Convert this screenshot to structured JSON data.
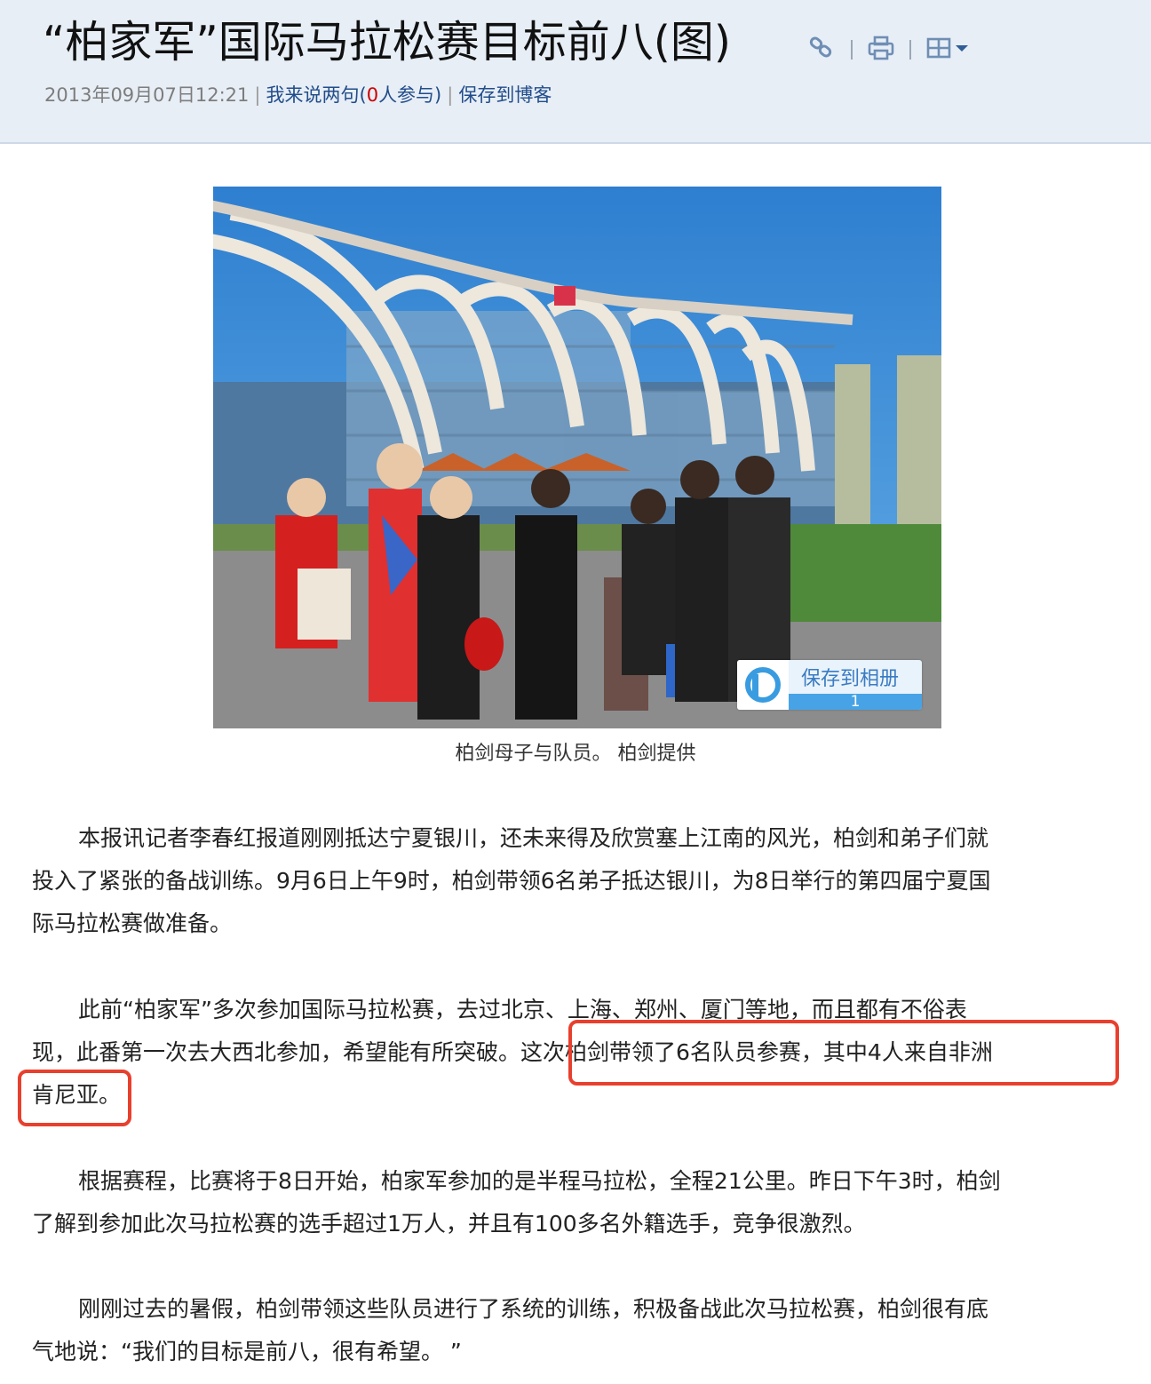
{
  "article": {
    "title": "“柏家军”国际马拉松赛目标前八(图)",
    "date": "2013年09月07日12:21",
    "comment_pre": "我来说两句(",
    "comment_count": "0",
    "comment_post": "人参与)",
    "save_blog": "保存到博客"
  },
  "toolbar": {
    "icons": [
      "link-icon",
      "print-icon",
      "font-size-icon"
    ]
  },
  "photo": {
    "save_album_label": "保存到相册",
    "save_album_count": "1",
    "caption": "柏剑母子与队员。 柏剑提供"
  },
  "paragraphs": [
    [
      "本报讯记者李春红报道刚刚抵达宁夏银川，还未来得及欣赏塞上江南的风光，柏剑和弟子们就",
      "投入了紧张的备战训练。9月6日上午9时，柏剑带领6名弟子抵达银川，为8日举行的第四届宁夏国",
      "际马拉松赛做准备。"
    ],
    [
      "此前“柏家军”多次参加国际马拉松赛，去过北京、上海、郑州、厦门等地，而且都有不俗表",
      "现，此番第一次去大西北参加，希望能有所突破。这次柏剑带领了6名队员参赛，其中4人来自非洲",
      "肯尼亚。"
    ],
    [
      "根据赛程，比赛将于8日开始，柏家军参加的是半程马拉松，全程21公里。昨日下午3时，柏剑",
      "了解到参加此次马拉松赛的选手超过1万人，并且有100多名外籍选手，竞争很激烈。"
    ],
    [
      "刚刚过去的暑假，柏剑带领这些队员进行了系统的训练，积极备战此次马拉松赛，柏剑很有底",
      "气地说：“我们的目标是前八，很有希望。 ”"
    ]
  ],
  "colors": {
    "header_bg": "#e7eef6",
    "link": "#224d8a",
    "highlight_box": "#e8402e"
  }
}
